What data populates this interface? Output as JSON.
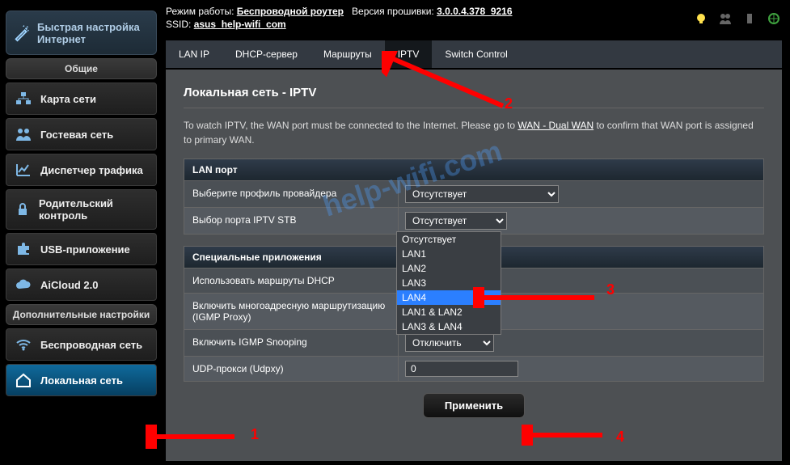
{
  "topbar": {
    "mode_label": "Режим работы:",
    "mode_value": "Беспроводной роутер",
    "fw_label": "Версия прошивки:",
    "fw_value": "3.0.0.4.378_9216",
    "ssid_label": "SSID:",
    "ssid_value": "asus_help-wifi_com"
  },
  "quick_setup": "Быстрая настройка Интернет",
  "section_general": "Общие",
  "menu_general": [
    "Карта сети",
    "Гостевая сеть",
    "Диспетчер трафика",
    "Родительский контроль",
    "USB-приложение",
    "AiCloud 2.0"
  ],
  "section_advanced": "Дополнительные настройки",
  "menu_advanced": [
    "Беспроводная сеть",
    "Локальная сеть"
  ],
  "tabs": [
    "LAN IP",
    "DHCP-сервер",
    "Маршруты",
    "IPTV",
    "Switch Control"
  ],
  "active_tab": 3,
  "page_title": "Локальная сеть - IPTV",
  "desc_a": "To watch IPTV, the WAN port must be connected to the Internet. Please go to ",
  "desc_link": "WAN - Dual WAN",
  "desc_b": " to confirm that WAN port is assigned to primary WAN.",
  "panel1": {
    "title": "LAN порт",
    "row1_label": "Выберите профиль провайдера",
    "row1_value": "Отсутствует",
    "row2_label": "Выбор порта IPTV STB",
    "row2_value": "Отсутствует",
    "options": [
      "Отсутствует",
      "LAN1",
      "LAN2",
      "LAN3",
      "LAN4",
      "LAN1 & LAN2",
      "LAN3 & LAN4"
    ]
  },
  "panel2": {
    "title": "Специальные приложения",
    "row1_label": "Использовать маршруты DHCP",
    "row2_label": "Включить многоадресную маршрутизацию (IGMP Proxy)",
    "row3_label": "Включить IGMP Snooping",
    "row3_value": "Отключить",
    "row4_label": "UDP-прокси (Udpxy)",
    "row4_value": "0"
  },
  "apply": "Применить",
  "annotations": {
    "n1": "1",
    "n2": "2",
    "n3": "3",
    "n4": "4"
  },
  "watermark": "help-wifi.com"
}
